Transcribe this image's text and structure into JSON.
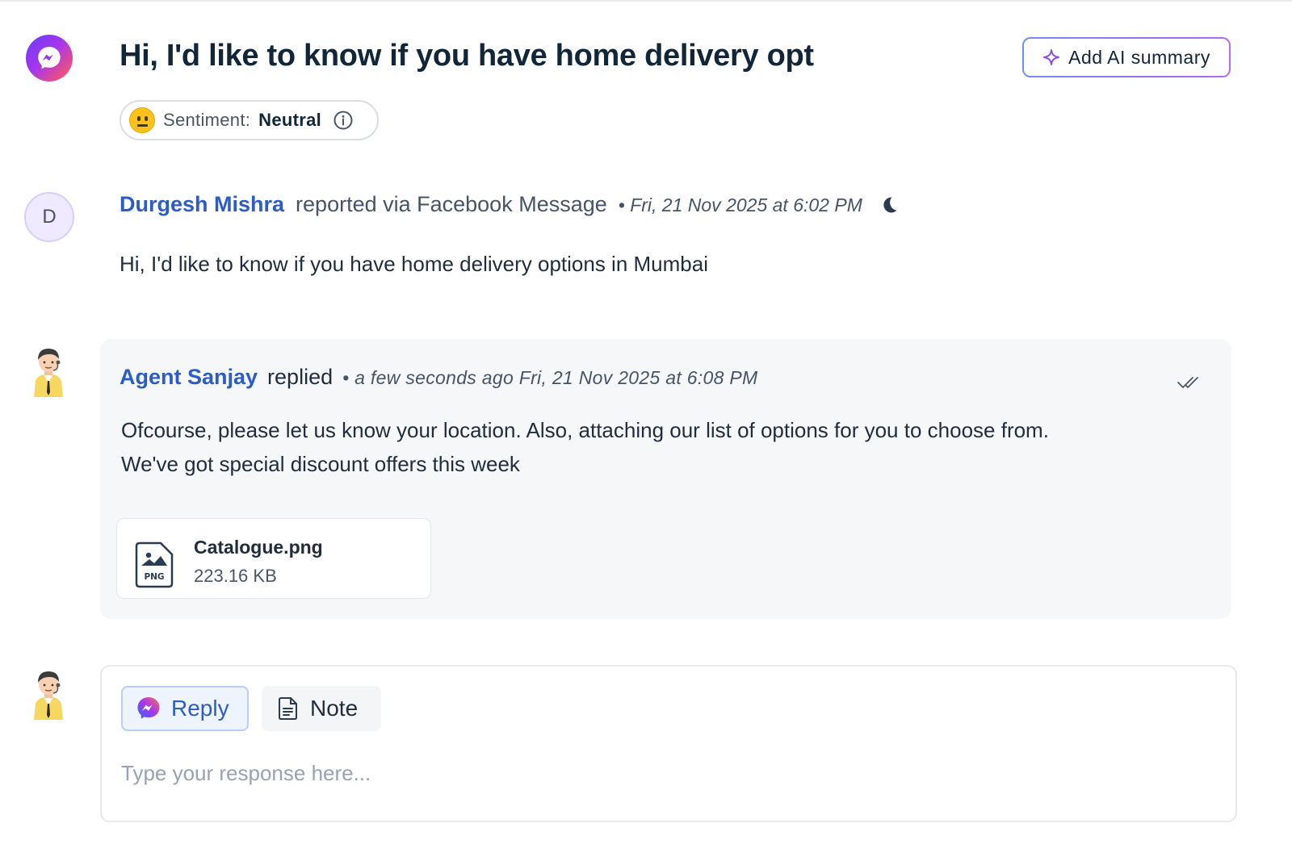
{
  "ticket": {
    "title": "Hi, I'd like to know if you have home delivery opt",
    "channel_icon": "facebook-messenger-icon",
    "ai_summary_label": "Add AI summary"
  },
  "sentiment": {
    "label": "Sentiment:",
    "value": "Neutral",
    "emoji": "neutral-face-icon"
  },
  "original_message": {
    "avatar_initial": "D",
    "author": "Durgesh Mishra",
    "via_text": "reported via Facebook Message",
    "timestamp": "• Fri, 21 Nov 2025 at 6:02 PM",
    "time_icon": "moon-icon",
    "body": "Hi, I'd like to know if you have home delivery options in Mumbai"
  },
  "reply": {
    "author": "Agent Sanjay",
    "action": "replied",
    "timestamp": "• a few seconds ago Fri, 21 Nov 2025 at 6:08 PM",
    "status_icon": "double-check-icon",
    "body_line1": "Ofcourse, please let us know your location. Also, attaching our list of options for you to choose from.",
    "body_line2": "We've got special discount offers this week",
    "attachment": {
      "name": "Catalogue.png",
      "size": "223.16 KB",
      "type_label": "PNG"
    }
  },
  "composer": {
    "reply_tab": "Reply",
    "note_tab": "Note",
    "placeholder": "Type your response here..."
  },
  "colors": {
    "link_blue": "#2c5cc5",
    "card_bg": "#f5f7f9",
    "title": "#12263a"
  }
}
